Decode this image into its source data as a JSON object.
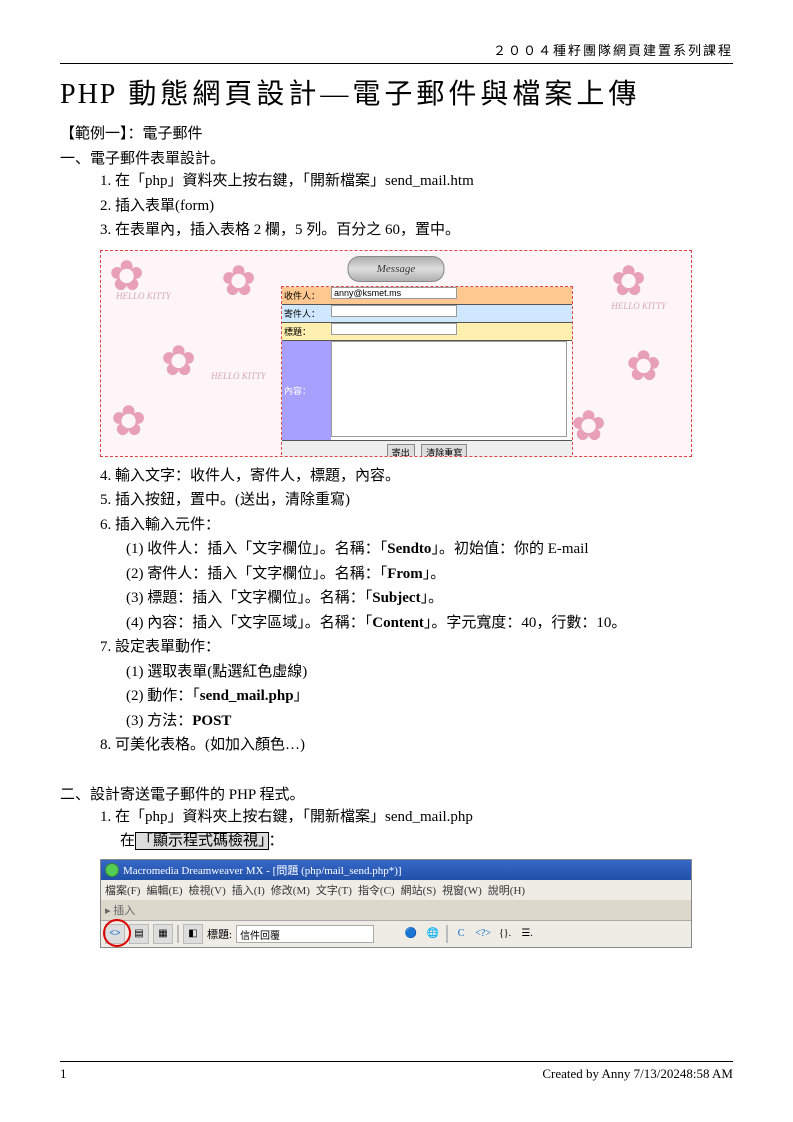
{
  "header": "２００４種籽團隊網頁建置系列課程",
  "title_php": "PHP",
  "title_rest": " 動態網頁設計—電子郵件與檔案上傳",
  "example_label": "【範例一】：電子郵件",
  "section1_heading": "一、電子郵件表單設計。",
  "s1": {
    "i1_pre": "1. 在「php」資料夾上按右鍵，「開新檔案」",
    "i1_code": "send_mail.htm",
    "i2": "2. 插入表單(form)",
    "i3": "3. 在表單內，插入表格 2 欄，5 列。百分之 60，置中。",
    "i4": "4. 輸入文字：收件人，寄件人，標題，內容。",
    "i5": "5. 插入按鈕，置中。(送出，清除重寫)",
    "i6": "6. 插入輸入元件：",
    "i6_1_pre": "(1) 收件人：插入「文字欄位」。名稱：「",
    "i6_1_b": "Sendto",
    "i6_1_post": "」。初始值：你的 E-mail",
    "i6_2_pre": "(2) 寄件人：插入「文字欄位」。名稱：「",
    "i6_2_b": "From",
    "i6_2_post": "」。",
    "i6_3_pre": "(3) 標題：插入「文字欄位」。名稱：「",
    "i6_3_b": "Subject",
    "i6_3_post": "」。",
    "i6_4_pre": "(4) 內容：插入「文字區域」。名稱：「",
    "i6_4_b": "Content",
    "i6_4_post": "」。字元寬度：40，行數：10。",
    "i7": "7. 設定表單動作：",
    "i7_1": "(1) 選取表單(點選紅色虛線)",
    "i7_2_pre": "(2) 動作：「",
    "i7_2_b": "send_mail.php",
    "i7_2_post": "」",
    "i7_3_pre": "(3) 方法：",
    "i7_3_b": "POST",
    "i8": "8. 可美化表格。(如加入顏色…)"
  },
  "form_ui": {
    "banner": "Message",
    "row1_label": "收件人：",
    "row1_value": "anny@ksmet.ms",
    "row2_label": "寄件人：",
    "row3_label": "標題：",
    "row4_label": "內容：",
    "btn_submit": "寄出",
    "btn_reset": "清除重寫",
    "hellokitty": "HELLO KITTY"
  },
  "section2_heading": "二、設計寄送電子郵件的 PHP 程式。",
  "s2": {
    "i1_pre": "1.  在「php」資料夾上按右鍵，「開新檔案」",
    "i1_code": "send_mail.php",
    "i1_line2_pre": "在",
    "i1_line2_btn": "「顯示程式碼檢視」",
    "i1_line2_post": "："
  },
  "dw": {
    "title": "Macromedia Dreamweaver MX - [問題 (php/mail_send.php*)]",
    "menu": {
      "file": "檔案(F)",
      "edit": "編輯(E)",
      "view": "檢視(V)",
      "insert": "插入(I)",
      "modify": "修改(M)",
      "text": "文字(T)",
      "commands": "指令(C)",
      "site": "網站(S)",
      "window": "視窗(W)",
      "help": "說明(H)"
    },
    "tab": "▸ 插入",
    "toolbar": {
      "label": "標題:",
      "value": "信件回覆"
    }
  },
  "footer": {
    "page": "1",
    "credit": "Created by Anny 7/13/20248:58 AM"
  }
}
